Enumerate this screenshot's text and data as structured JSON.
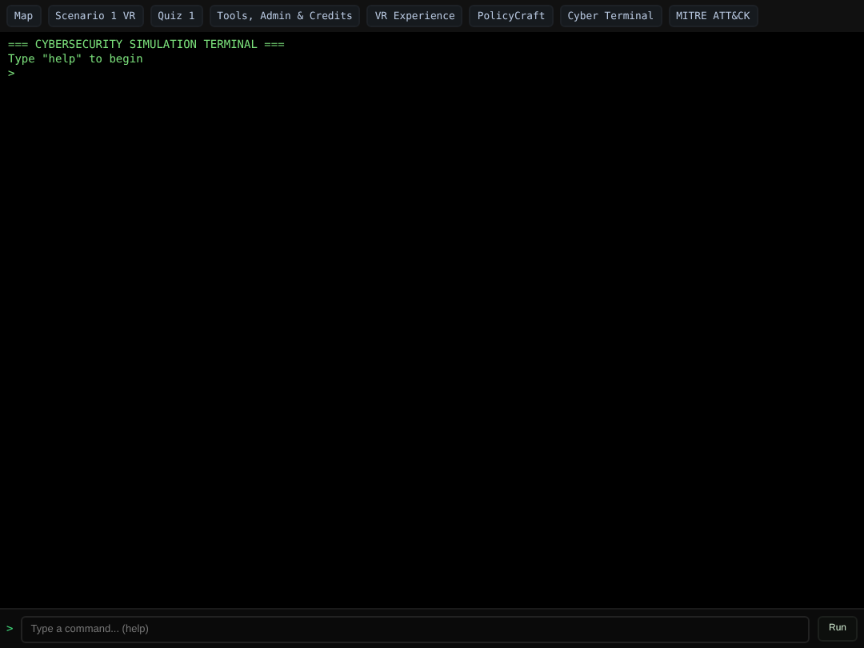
{
  "nav": {
    "tabs": [
      "Map",
      "Scenario 1 VR",
      "Quiz 1",
      "Tools, Admin & Credits",
      "VR Experience",
      "PolicyCraft",
      "Cyber Terminal",
      "MITRE ATT&CK"
    ]
  },
  "terminal": {
    "lines": [
      "=== CYBERSECURITY SIMULATION TERMINAL ===",
      "Type \"help\" to begin",
      ">"
    ]
  },
  "command_bar": {
    "prompt": ">",
    "placeholder": "Type a command... (help)",
    "button": "Run"
  }
}
